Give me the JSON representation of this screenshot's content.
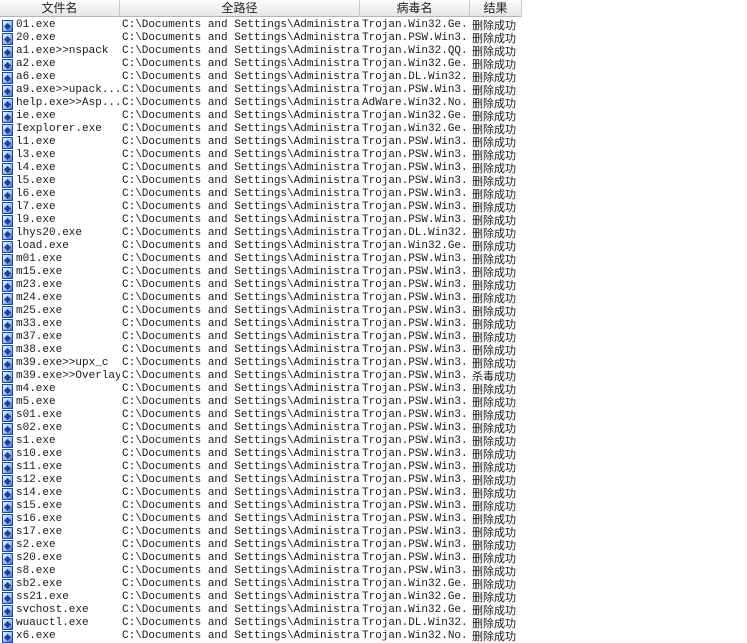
{
  "columns": {
    "filename": "文件名",
    "fullpath": "全路径",
    "virus": "病毒名",
    "result": "结果"
  },
  "icons": {
    "file": "executable-file-icon"
  },
  "rows": [
    {
      "name": "01.exe",
      "path": "C:\\Documents and Settings\\Administra...",
      "virus": "Trojan.Win32.Ge...",
      "result": "删除成功"
    },
    {
      "name": "20.exe",
      "path": "C:\\Documents and Settings\\Administra...",
      "virus": "Trojan.PSW.Win3...",
      "result": "删除成功"
    },
    {
      "name": "a1.exe>>nspack",
      "path": "C:\\Documents and Settings\\Administra...",
      "virus": "Trojan.Win32.QQ...",
      "result": "删除成功"
    },
    {
      "name": "a2.exe",
      "path": "C:\\Documents and Settings\\Administra...",
      "virus": "Trojan.Win32.Ge...",
      "result": "删除成功"
    },
    {
      "name": "a6.exe",
      "path": "C:\\Documents and Settings\\Administra...",
      "virus": "Trojan.DL.Win32...",
      "result": "删除成功"
    },
    {
      "name": "a9.exe>>upack...",
      "path": "C:\\Documents and Settings\\Administra...",
      "virus": "Trojan.PSW.Win3...",
      "result": "删除成功"
    },
    {
      "name": "help.exe>>Asp...",
      "path": "C:\\Documents and Settings\\Administra...",
      "virus": "AdWare.Win32.No...",
      "result": "删除成功"
    },
    {
      "name": "ie.exe",
      "path": "C:\\Documents and Settings\\Administra...",
      "virus": "Trojan.Win32.Ge...",
      "result": "删除成功"
    },
    {
      "name": "Iexplorer.exe",
      "path": "C:\\Documents and Settings\\Administra...",
      "virus": "Trojan.Win32.Ge...",
      "result": "删除成功"
    },
    {
      "name": "l1.exe",
      "path": "C:\\Documents and Settings\\Administra...",
      "virus": "Trojan.PSW.Win3...",
      "result": "删除成功"
    },
    {
      "name": "l3.exe",
      "path": "C:\\Documents and Settings\\Administra...",
      "virus": "Trojan.PSW.Win3...",
      "result": "删除成功"
    },
    {
      "name": "l4.exe",
      "path": "C:\\Documents and Settings\\Administra...",
      "virus": "Trojan.PSW.Win3...",
      "result": "删除成功"
    },
    {
      "name": "l5.exe",
      "path": "C:\\Documents and Settings\\Administra...",
      "virus": "Trojan.PSW.Win3...",
      "result": "删除成功"
    },
    {
      "name": "l6.exe",
      "path": "C:\\Documents and Settings\\Administra...",
      "virus": "Trojan.PSW.Win3...",
      "result": "删除成功"
    },
    {
      "name": "l7.exe",
      "path": "C:\\Documents and Settings\\Administra...",
      "virus": "Trojan.PSW.Win3...",
      "result": "删除成功"
    },
    {
      "name": "l9.exe",
      "path": "C:\\Documents and Settings\\Administra...",
      "virus": "Trojan.PSW.Win3...",
      "result": "删除成功"
    },
    {
      "name": "lhys20.exe",
      "path": "C:\\Documents and Settings\\Administra...",
      "virus": "Trojan.DL.Win32...",
      "result": "删除成功"
    },
    {
      "name": "load.exe",
      "path": "C:\\Documents and Settings\\Administra...",
      "virus": "Trojan.Win32.Ge...",
      "result": "删除成功"
    },
    {
      "name": "m01.exe",
      "path": "C:\\Documents and Settings\\Administra...",
      "virus": "Trojan.PSW.Win3...",
      "result": "删除成功"
    },
    {
      "name": "m15.exe",
      "path": "C:\\Documents and Settings\\Administra...",
      "virus": "Trojan.PSW.Win3...",
      "result": "删除成功"
    },
    {
      "name": "m23.exe",
      "path": "C:\\Documents and Settings\\Administra...",
      "virus": "Trojan.PSW.Win3...",
      "result": "删除成功"
    },
    {
      "name": "m24.exe",
      "path": "C:\\Documents and Settings\\Administra...",
      "virus": "Trojan.PSW.Win3...",
      "result": "删除成功"
    },
    {
      "name": "m25.exe",
      "path": "C:\\Documents and Settings\\Administra...",
      "virus": "Trojan.PSW.Win3...",
      "result": "删除成功"
    },
    {
      "name": "m33.exe",
      "path": "C:\\Documents and Settings\\Administra...",
      "virus": "Trojan.PSW.Win3...",
      "result": "删除成功"
    },
    {
      "name": "m37.exe",
      "path": "C:\\Documents and Settings\\Administra...",
      "virus": "Trojan.PSW.Win3...",
      "result": "删除成功"
    },
    {
      "name": "m38.exe",
      "path": "C:\\Documents and Settings\\Administra...",
      "virus": "Trojan.PSW.Win3...",
      "result": "删除成功"
    },
    {
      "name": "m39.exe>>upx_c",
      "path": "C:\\Documents and Settings\\Administra...",
      "virus": "Trojan.PSW.Win3...",
      "result": "删除成功"
    },
    {
      "name": "m39.exe>>Overlay",
      "path": "C:\\Documents and Settings\\Administra...",
      "virus": "Trojan.PSW.Win3...",
      "result": "杀毒成功"
    },
    {
      "name": "m4.exe",
      "path": "C:\\Documents and Settings\\Administra...",
      "virus": "Trojan.PSW.Win3...",
      "result": "删除成功"
    },
    {
      "name": "m5.exe",
      "path": "C:\\Documents and Settings\\Administra...",
      "virus": "Trojan.PSW.Win3...",
      "result": "删除成功"
    },
    {
      "name": "s01.exe",
      "path": "C:\\Documents and Settings\\Administra...",
      "virus": "Trojan.PSW.Win3...",
      "result": "删除成功"
    },
    {
      "name": "s02.exe",
      "path": "C:\\Documents and Settings\\Administra...",
      "virus": "Trojan.PSW.Win3...",
      "result": "删除成功"
    },
    {
      "name": "s1.exe",
      "path": "C:\\Documents and Settings\\Administra...",
      "virus": "Trojan.PSW.Win3...",
      "result": "删除成功"
    },
    {
      "name": "s10.exe",
      "path": "C:\\Documents and Settings\\Administra...",
      "virus": "Trojan.PSW.Win3...",
      "result": "删除成功"
    },
    {
      "name": "s11.exe",
      "path": "C:\\Documents and Settings\\Administra...",
      "virus": "Trojan.PSW.Win3...",
      "result": "删除成功"
    },
    {
      "name": "s12.exe",
      "path": "C:\\Documents and Settings\\Administra...",
      "virus": "Trojan.PSW.Win3...",
      "result": "删除成功"
    },
    {
      "name": "s14.exe",
      "path": "C:\\Documents and Settings\\Administra...",
      "virus": "Trojan.PSW.Win3...",
      "result": "删除成功"
    },
    {
      "name": "s15.exe",
      "path": "C:\\Documents and Settings\\Administra...",
      "virus": "Trojan.PSW.Win3...",
      "result": "删除成功"
    },
    {
      "name": "s16.exe",
      "path": "C:\\Documents and Settings\\Administra...",
      "virus": "Trojan.PSW.Win3...",
      "result": "删除成功"
    },
    {
      "name": "s17.exe",
      "path": "C:\\Documents and Settings\\Administra...",
      "virus": "Trojan.PSW.Win3...",
      "result": "删除成功"
    },
    {
      "name": "s2.exe",
      "path": "C:\\Documents and Settings\\Administra...",
      "virus": "Trojan.PSW.Win3...",
      "result": "删除成功"
    },
    {
      "name": "s20.exe",
      "path": "C:\\Documents and Settings\\Administra...",
      "virus": "Trojan.PSW.Win3...",
      "result": "删除成功"
    },
    {
      "name": "s8.exe",
      "path": "C:\\Documents and Settings\\Administra...",
      "virus": "Trojan.PSW.Win3...",
      "result": "删除成功"
    },
    {
      "name": "sb2.exe",
      "path": "C:\\Documents and Settings\\Administra...",
      "virus": "Trojan.Win32.Ge...",
      "result": "删除成功"
    },
    {
      "name": "ss21.exe",
      "path": "C:\\Documents and Settings\\Administra...",
      "virus": "Trojan.Win32.Ge...",
      "result": "删除成功"
    },
    {
      "name": "svchost.exe",
      "path": "C:\\Documents and Settings\\Administra...",
      "virus": "Trojan.Win32.Ge...",
      "result": "删除成功"
    },
    {
      "name": "wuauctl.exe",
      "path": "C:\\Documents and Settings\\Administra...",
      "virus": "Trojan.DL.Win32...",
      "result": "删除成功"
    },
    {
      "name": "x6.exe",
      "path": "C:\\Documents and Settings\\Administra...",
      "virus": "Trojan.Win32.No...",
      "result": "删除成功"
    }
  ]
}
